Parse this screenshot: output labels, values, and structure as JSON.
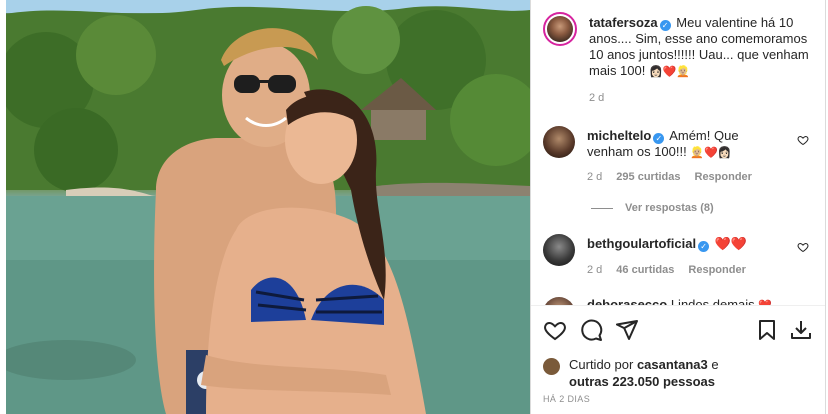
{
  "post": {
    "author": {
      "username": "tatafersoza",
      "verified": true,
      "caption": "Meu valentine há 10 anos.... Sim, esse ano comemoramos 10 anos juntos!!!!!! Uau... que venham mais 100!",
      "caption_emoji": "👩🏻❤️👱🏼",
      "time": "2 d"
    },
    "comments": [
      {
        "username": "micheltelo",
        "verified": true,
        "text": "Amém! Que venham os 100!!!",
        "emoji": "👱🏼❤️👩🏻",
        "time": "2 d",
        "likes": "295 curtidas",
        "reply_label": "Responder",
        "view_replies": "Ver respostas (8)"
      },
      {
        "username": "bethgoulartoficial",
        "verified": true,
        "text": "",
        "emoji": "❤️❤️",
        "time": "2 d",
        "likes": "46 curtidas",
        "reply_label": "Responder"
      },
      {
        "username": "deborasecco",
        "text": "Lindos demais",
        "emoji": "❤️"
      }
    ],
    "liked_by_prefix": "Curtido por",
    "liked_by_user": "casantana3",
    "liked_by_suffix": "e",
    "liked_by_others": "outras 223.050 pessoas",
    "date": "HÁ 2 DIAS"
  },
  "actions": [
    "heart-icon",
    "comment-icon",
    "share-icon",
    "bookmark-icon",
    "download-icon"
  ],
  "colors": {
    "verified": "#3897f0",
    "story_ring": "#d6249f",
    "heart_red": "#ed4956",
    "text": "#262626",
    "muted": "#8e8e8e"
  }
}
